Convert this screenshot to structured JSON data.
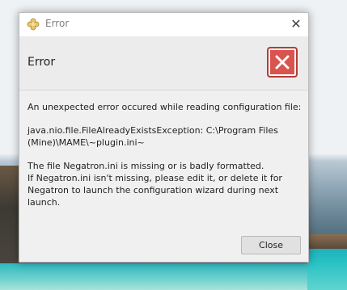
{
  "window": {
    "title": "Error",
    "close_glyph": "✕",
    "app_icon": "flower-icon"
  },
  "header": {
    "text": "Error",
    "icon": "error-x-icon",
    "icon_color": "#d9534f"
  },
  "message": {
    "line1": "An unexpected error occured while reading configuration file:",
    "exception": "java.nio.file.FileAlreadyExistsException: C:\\Program Files (Mine)\\MAME\\~plugin.ini~",
    "details": [
      "The file Negatron.ini is missing or is badly formatted.",
      "If Negatron.ini isn't missing, please edit it, or delete it for Negatron to launch the configuration wizard during next launch."
    ]
  },
  "buttons": {
    "close_label": "Close"
  }
}
